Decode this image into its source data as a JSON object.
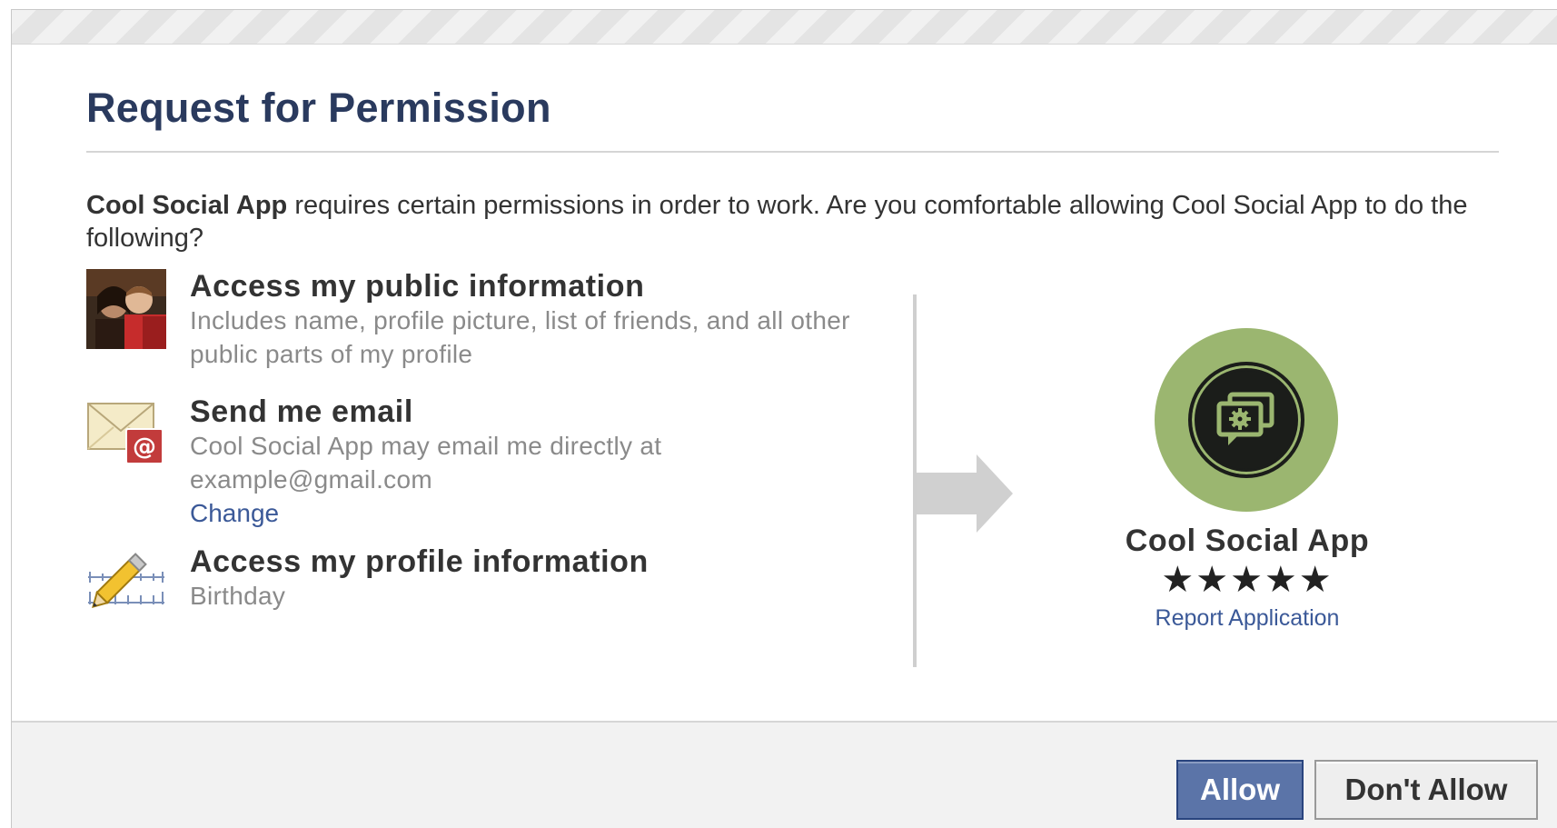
{
  "dialog": {
    "title": "Request for Permission",
    "intro_app_name": "Cool Social App",
    "intro_text": " requires certain permissions in order to work. Are you comfortable allowing Cool Social App to do the following?"
  },
  "permissions": [
    {
      "icon": "profile-photo",
      "title": "Access my public information",
      "description": "Includes name, profile picture, list of friends, and all other public parts of my profile"
    },
    {
      "icon": "email-envelope-icon",
      "title": "Send me email",
      "description": "Cool Social App may email me directly at example@gmail.com",
      "link": "Change"
    },
    {
      "icon": "pencil-ruler-icon",
      "title": "Access my profile information",
      "description": "Birthday"
    }
  ],
  "app": {
    "name": "Cool Social App",
    "stars": "★★★★★",
    "rating": 5,
    "report_link": "Report Application",
    "logo_color": "#9bb670"
  },
  "buttons": {
    "allow": "Allow",
    "deny": "Don't Allow"
  },
  "colors": {
    "title": "#2a3a5e",
    "link": "#3b5998",
    "allow_button": "#5b74a8"
  }
}
